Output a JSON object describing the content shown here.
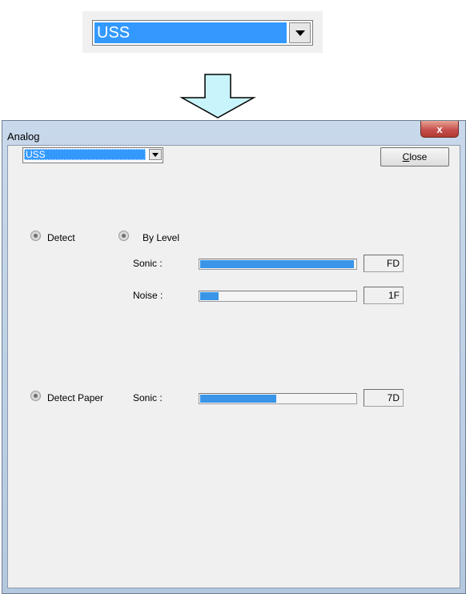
{
  "zoom_combo": {
    "value": "USS"
  },
  "window": {
    "title": "Analog",
    "close_glyph": "x"
  },
  "combo": {
    "value": "USS"
  },
  "close_button": {
    "label_accel": "C",
    "label_rest": "lose"
  },
  "detect": {
    "label": "Detect",
    "by_level_label": "By Level",
    "sonic": {
      "label": "Sonic :",
      "value": "FD",
      "level": 0.99
    },
    "noise": {
      "label": "Noise :",
      "value": "1F",
      "level": 0.12
    }
  },
  "detect_paper": {
    "label": "Detect Paper",
    "sonic": {
      "label": "Sonic :",
      "value": "7D",
      "level": 0.49
    }
  },
  "colors": {
    "selection": "#3399ff",
    "bar_fill": "#3a95e8",
    "arrow_fill": "#c8f4fb"
  }
}
